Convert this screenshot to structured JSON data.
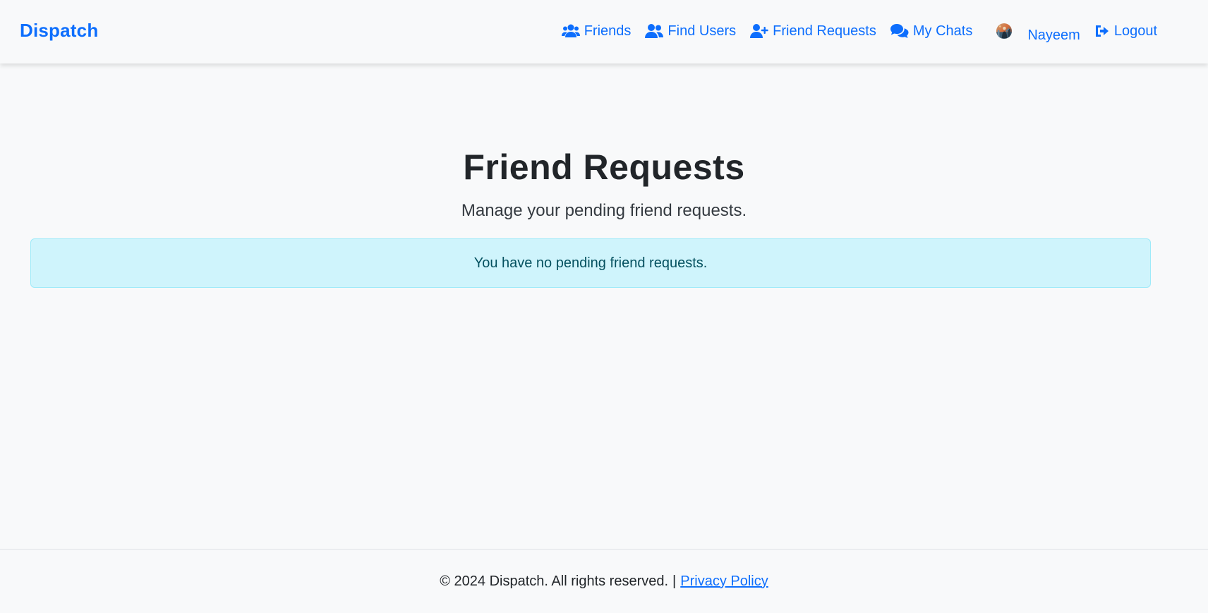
{
  "brand": {
    "name": "Dispatch",
    "color": "#0d6efd"
  },
  "nav": {
    "items": [
      {
        "label": "Friends",
        "icon": "user-group-icon"
      },
      {
        "label": "Find Users",
        "icon": "users-icon"
      },
      {
        "label": "Friend Requests",
        "icon": "user-plus-icon"
      },
      {
        "label": "My Chats",
        "icon": "comments-icon"
      }
    ],
    "profile": {
      "name": "Nayeem",
      "icon": "avatar"
    },
    "logout": {
      "label": "Logout",
      "icon": "sign-out-icon"
    }
  },
  "main": {
    "title": "Friend Requests",
    "subtitle": "Manage your pending friend requests.",
    "alert": {
      "text": "You have no pending friend requests.",
      "background": "#cff4fc",
      "text_color": "#055160"
    }
  },
  "footer": {
    "copyright": "© 2024 Dispatch. All rights reserved.",
    "separator": "|",
    "privacy_link": "Privacy Policy"
  }
}
